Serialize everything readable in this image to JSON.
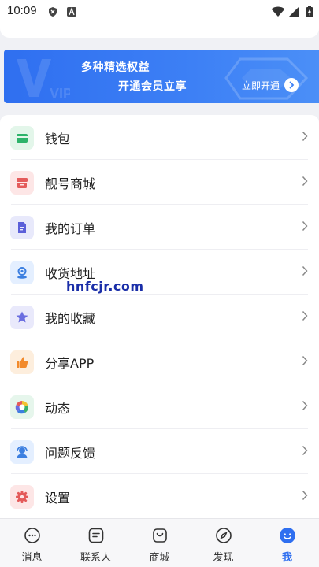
{
  "status_bar": {
    "time": "10:09"
  },
  "vip": {
    "title": "多种精选权益",
    "subtitle": "开通会员立享",
    "button_label": "立即开通",
    "deco_text": "VIP"
  },
  "menu": {
    "items": [
      {
        "label": "钱包",
        "icon": "wallet-icon",
        "color": "#2db36a",
        "bg": "#e3f6ea"
      },
      {
        "label": "靓号商城",
        "icon": "shop-icon",
        "color": "#e45b5b",
        "bg": "#fde6e6"
      },
      {
        "label": "我的订单",
        "icon": "order-icon",
        "color": "#5b5fd9",
        "bg": "#e8e9fb"
      },
      {
        "label": "收货地址",
        "icon": "location-icon",
        "color": "#3c7fe0",
        "bg": "#e4efff"
      },
      {
        "label": "我的收藏",
        "icon": "star-icon",
        "color": "#6a6ee0",
        "bg": "#e9e9fb"
      },
      {
        "label": "分享APP",
        "icon": "thumbs-up-icon",
        "color": "#f28a2b",
        "bg": "#fdeedd"
      },
      {
        "label": "动态",
        "icon": "moments-icon",
        "color": "#3ab06c",
        "bg": "#e6f6ec"
      },
      {
        "label": "问题反馈",
        "icon": "support-icon",
        "color": "#3c7fe0",
        "bg": "#e4efff"
      },
      {
        "label": "设置",
        "icon": "gear-icon",
        "color": "#e45b5b",
        "bg": "#fde6e6"
      }
    ]
  },
  "watermark": "hnfcjr.com",
  "tabs": [
    {
      "label": "消息",
      "icon": "message-icon"
    },
    {
      "label": "联系人",
      "icon": "contacts-icon"
    },
    {
      "label": "商城",
      "icon": "mall-bag-icon"
    },
    {
      "label": "发现",
      "icon": "compass-icon"
    },
    {
      "label": "我",
      "icon": "me-icon",
      "active": true
    }
  ],
  "colors": {
    "accent": "#2f6ff0",
    "background": "#f0f1f5"
  }
}
